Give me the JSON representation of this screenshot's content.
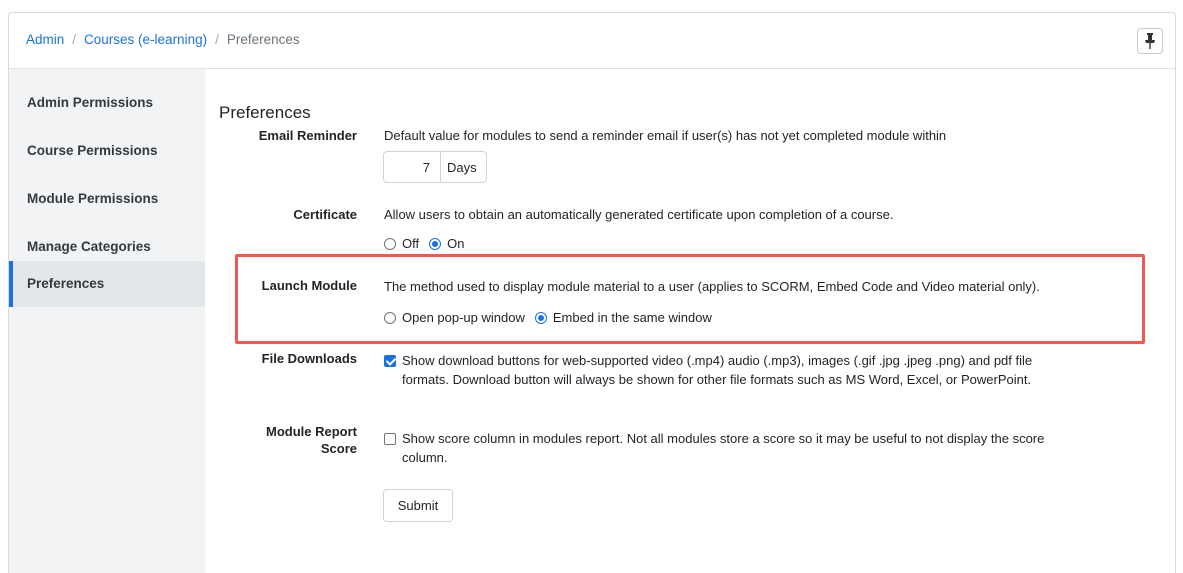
{
  "breadcrumb": {
    "items": [
      "Admin",
      "Courses (e-learning)"
    ],
    "separator": "/",
    "current": "Preferences"
  },
  "toolbar": {
    "pin_icon": "pin-icon"
  },
  "sidebar": {
    "items": [
      {
        "label": "Admin Permissions"
      },
      {
        "label": "Course Permissions"
      },
      {
        "label": "Module Permissions"
      },
      {
        "label": "Manage Categories"
      },
      {
        "label": "Preferences",
        "active": true
      }
    ]
  },
  "main": {
    "title": "Preferences",
    "email_reminder": {
      "label": "Email Reminder",
      "description": "Default value for modules to send a reminder email if user(s) has not yet completed module within",
      "value": "7",
      "unit": "Days"
    },
    "certificate": {
      "label": "Certificate",
      "description": "Allow users to obtain an automatically generated certificate upon completion of a course.",
      "options": [
        "Off",
        "On"
      ],
      "selected": "On"
    },
    "launch_module": {
      "label": "Launch Module",
      "description": "The method used to display module material to a user (applies to SCORM, Embed Code and Video material only).",
      "options": [
        "Open pop-up window",
        "Embed in the same window"
      ],
      "selected": "Embed in the same window"
    },
    "file_downloads": {
      "label": "File Downloads",
      "checked": true,
      "line1": "Show download buttons for web-supported video (.mp4) audio (.mp3), images (.gif .jpg .jpeg .png) and pdf file",
      "line2": "formats. Download button will always be shown for other file formats such as MS Word, Excel, or PowerPoint."
    },
    "module_report_score": {
      "label_line1": "Module Report",
      "label_line2": "Score",
      "checked": false,
      "line1": "Show score column in modules report. Not all modules store a score so it may be useful to not display the score",
      "line2": "column."
    },
    "submit_label": "Submit"
  },
  "colors": {
    "accent": "#1a73d9",
    "highlight": "#ee5a52",
    "sidebar_bg": "#f1f3f5"
  }
}
